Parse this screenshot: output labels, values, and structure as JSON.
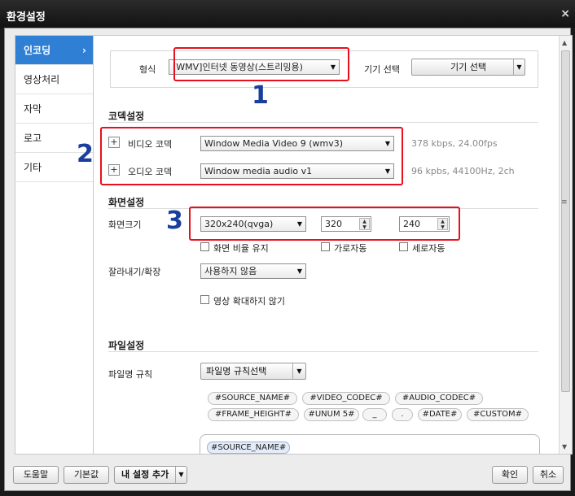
{
  "window": {
    "title": "환경설정",
    "close_glyph": "×"
  },
  "sidebar": {
    "items": [
      {
        "label": "인코딩",
        "arrow": "›"
      },
      {
        "label": "영상처리"
      },
      {
        "label": "자막"
      },
      {
        "label": "로고"
      },
      {
        "label": "기타"
      }
    ]
  },
  "format": {
    "label": "형식",
    "value": "[WMV]인터넷 동영상(스트리밍용)",
    "device_label": "기기 선택",
    "device_button": "기기 선택"
  },
  "codec": {
    "title": "코덱설정",
    "video_label": "비디오 코덱",
    "video_value": "Window Media Video 9 (wmv3)",
    "video_info": "378 kbps, 24.00fps",
    "audio_label": "오디오 코덱",
    "audio_value": "Window media audio v1",
    "audio_info": "96 kpbs, 44100Hz, 2ch"
  },
  "screen": {
    "title": "화면설정",
    "size_label": "화면크기",
    "size_value": "320x240(qvga)",
    "width": "320",
    "height": "240",
    "keep_ratio": "화면 비율 유지",
    "auto_width": "가로자동",
    "auto_height": "세로자동",
    "crop_label": "잘라내기/확장",
    "crop_value": "사용하지 않음",
    "no_enlarge": "영상 확대하지 않기"
  },
  "file": {
    "title": "파일설정",
    "rule_label": "파일명 규칙",
    "rule_button": "파일명 규칙선택",
    "tokens": [
      "#SOURCE_NAME#",
      "#VIDEO_CODEC#",
      "#AUDIO_CODEC#",
      "#FRAME_HEIGHT#",
      "#UNUM 5#",
      "_",
      ".",
      "#DATE#",
      "#CUSTOM#"
    ],
    "rule_value": "#SOURCE_NAME#"
  },
  "annotations": {
    "n1": "1",
    "n2": "2",
    "n3": "3"
  },
  "footer": {
    "help": "도움말",
    "default": "기본값",
    "my_settings": "내 설정 추가",
    "ok": "확인",
    "cancel": "취소"
  },
  "colors": {
    "accent": "#2f7fd4",
    "highlight_box": "#e8101c",
    "annotation": "#1a3e9e"
  }
}
